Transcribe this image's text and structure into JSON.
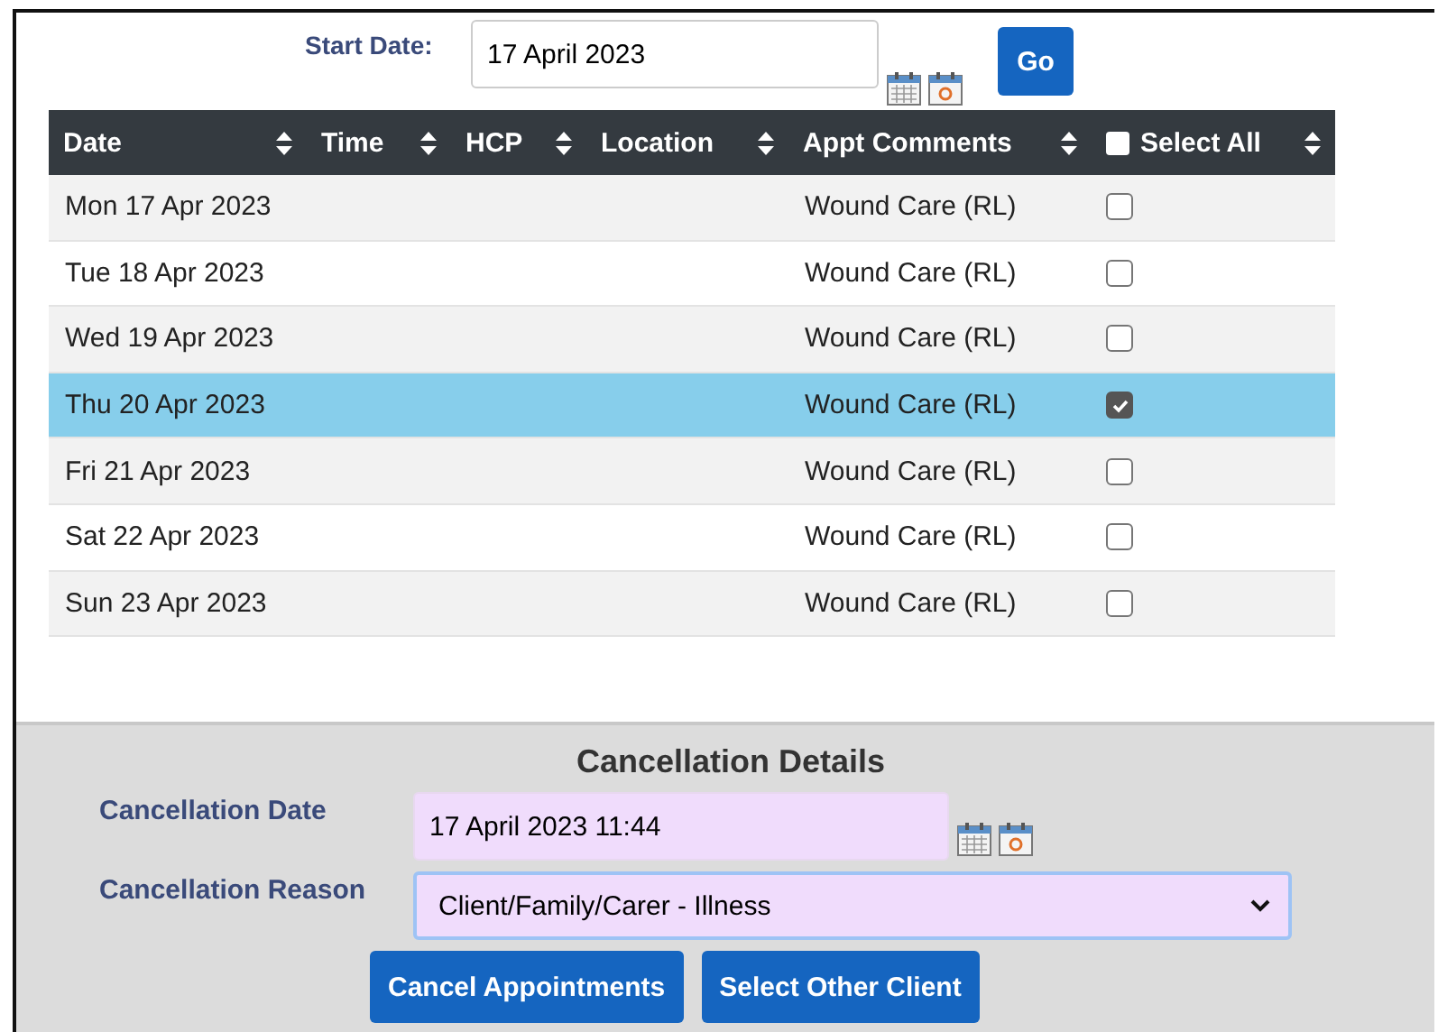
{
  "filter": {
    "label": "Start Date:",
    "value": "17 April 2023",
    "go": "Go"
  },
  "table": {
    "columns": [
      {
        "label": "Date"
      },
      {
        "label": "Time"
      },
      {
        "label": "HCP"
      },
      {
        "label": "Location"
      },
      {
        "label": "Appt Comments"
      },
      {
        "label": "Select All",
        "kind": "checkbox",
        "checked": false
      }
    ],
    "rows": [
      {
        "date": "Mon 17 Apr 2023",
        "comments": "Wound Care (RL)",
        "checked": false,
        "selected": false
      },
      {
        "date": "Tue 18 Apr 2023",
        "comments": "Wound Care (RL)",
        "checked": false,
        "selected": false
      },
      {
        "date": "Wed 19 Apr 2023",
        "comments": "Wound Care (RL)",
        "checked": false,
        "selected": false
      },
      {
        "date": "Thu 20 Apr 2023",
        "comments": "Wound Care (RL)",
        "checked": true,
        "selected": true
      },
      {
        "date": "Fri 21 Apr 2023",
        "comments": "Wound Care (RL)",
        "checked": false,
        "selected": false
      },
      {
        "date": "Sat 22 Apr 2023",
        "comments": "Wound Care (RL)",
        "checked": false,
        "selected": false
      },
      {
        "date": "Sun 23 Apr 2023",
        "comments": "Wound Care (RL)",
        "checked": false,
        "selected": false
      }
    ]
  },
  "cancellation": {
    "title": "Cancellation Details",
    "date_label": "Cancellation Date",
    "date_value": "17 April 2023 11:44",
    "reason_label": "Cancellation Reason",
    "reason_value": "Client/Family/Carer - Illness",
    "buttons": [
      "Cancel Appointments",
      "Select Other Client"
    ]
  }
}
